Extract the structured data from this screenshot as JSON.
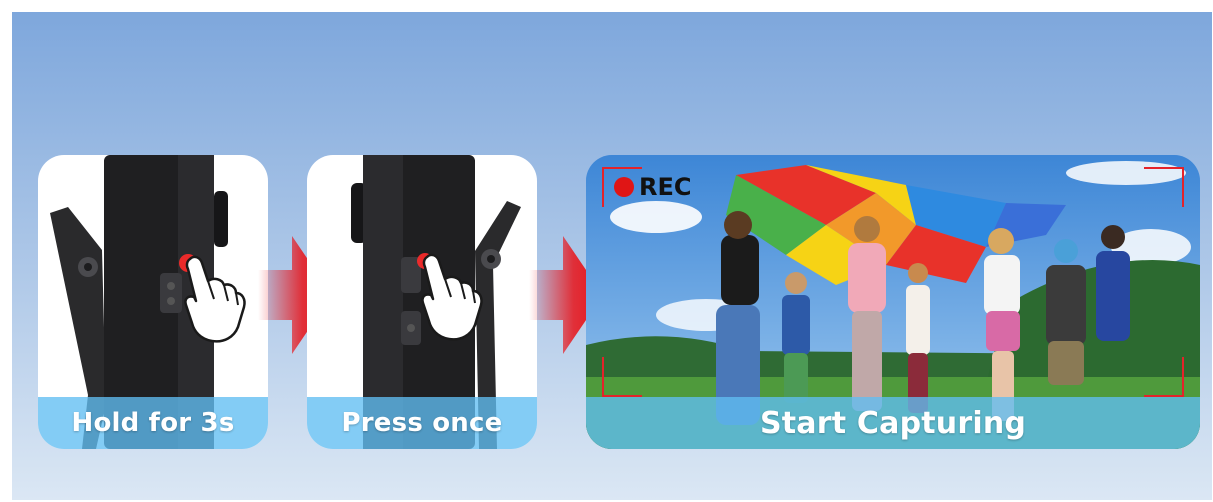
{
  "steps": [
    {
      "caption": "Hold for 3s",
      "icon": "hand-pointer-icon"
    },
    {
      "caption": "Press once",
      "icon": "hand-pointer-icon"
    },
    {
      "caption": "Start Capturing",
      "icon": "record-indicator"
    }
  ],
  "recording": {
    "label": "REC",
    "dot_color": "#e01515"
  },
  "colors": {
    "caption_bar": "#60bef2",
    "arrow_red": "#e8141a",
    "frame_corner": "#e4232a",
    "background_top": "#7ea7dc",
    "background_bottom": "#dbe7f4"
  }
}
